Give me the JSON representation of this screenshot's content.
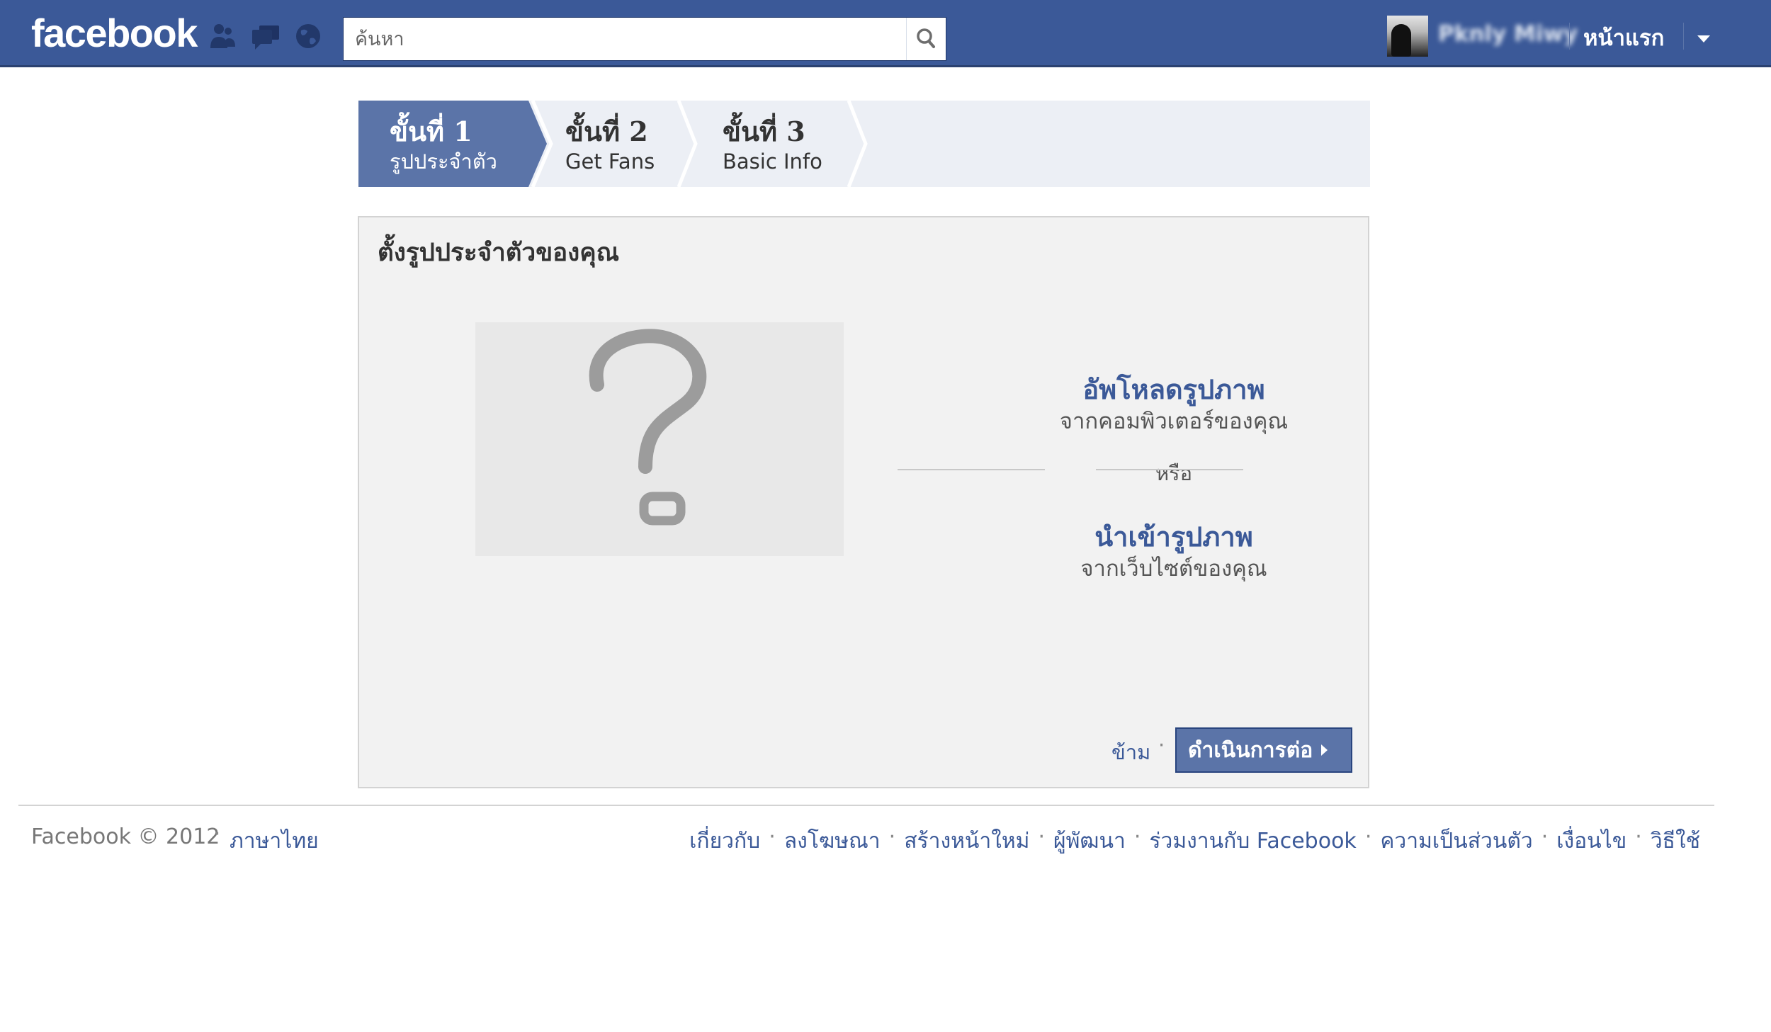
{
  "header": {
    "logo": "facebook",
    "search_placeholder": "ค้นหา",
    "user_name": "Pknly Miwy",
    "home_label": "หน้าแรก",
    "icons": [
      "friend-requests-icon",
      "messages-icon",
      "notifications-globe-icon",
      "search-icon",
      "account-menu-chevron-icon"
    ]
  },
  "steps": [
    {
      "title": "ขั้นที่ 1",
      "subtitle": "รูปประจำตัว",
      "active": true
    },
    {
      "title": "ขั้นที่ 2",
      "subtitle": "Get Fans",
      "active": false
    },
    {
      "title": "ขั้นที่ 3",
      "subtitle": "Basic Info",
      "active": false
    }
  ],
  "main": {
    "title": "ตั้งรูปประจำตัวของคุณ",
    "placeholder_symbol": "?",
    "upload": {
      "title": "อัพโหลดรูปภาพ",
      "subtitle": "จากคอมพิวเตอร์ของคุณ"
    },
    "or_label": "หรือ",
    "import": {
      "title": "นำเข้ารูปภาพ",
      "subtitle": "จากเว็บไซต์ของคุณ"
    },
    "skip_label": "ข้าม",
    "continue_label": "ดำเนินการต่อ"
  },
  "footer": {
    "copyright": "Facebook © 2012",
    "language": "ภาษาไทย",
    "links": [
      "เกี่ยวกับ",
      "ลงโฆษณา",
      "สร้างหน้าใหม่",
      "ผู้พัฒนา",
      "ร่วมงานกับ Facebook",
      "ความเป็นส่วนตัว",
      "เงื่อนไข",
      "วิธีใช้"
    ]
  },
  "colors": {
    "brand_blue": "#3b5998",
    "step_bar": "#eceff5",
    "panel": "#f2f2f2",
    "button": "#5b74a8"
  }
}
